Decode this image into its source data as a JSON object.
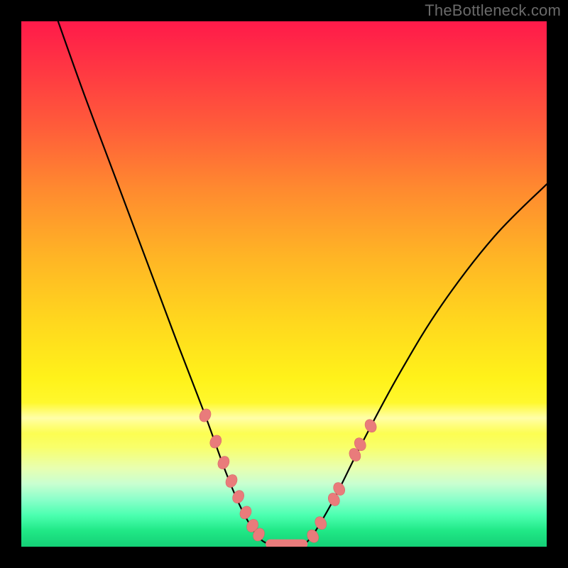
{
  "watermark": "TheBottleneck.com",
  "chart_data": {
    "type": "line",
    "title": "",
    "xlabel": "",
    "ylabel": "",
    "xlim": [
      0,
      100
    ],
    "ylim": [
      0,
      100
    ],
    "grid": false,
    "legend": false,
    "curves": [
      {
        "name": "left-branch",
        "points": [
          {
            "x": 7,
            "y": 100
          },
          {
            "x": 12,
            "y": 86
          },
          {
            "x": 18,
            "y": 70
          },
          {
            "x": 24,
            "y": 54
          },
          {
            "x": 30,
            "y": 38
          },
          {
            "x": 35,
            "y": 25
          },
          {
            "x": 39,
            "y": 14
          },
          {
            "x": 42,
            "y": 7
          },
          {
            "x": 45,
            "y": 2
          },
          {
            "x": 47,
            "y": 0.5
          }
        ]
      },
      {
        "name": "floor",
        "points": [
          {
            "x": 47,
            "y": 0.5
          },
          {
            "x": 54,
            "y": 0.5
          }
        ]
      },
      {
        "name": "right-branch",
        "points": [
          {
            "x": 54,
            "y": 0.5
          },
          {
            "x": 56,
            "y": 3
          },
          {
            "x": 60,
            "y": 10
          },
          {
            "x": 65,
            "y": 20
          },
          {
            "x": 72,
            "y": 33
          },
          {
            "x": 80,
            "y": 46
          },
          {
            "x": 90,
            "y": 59
          },
          {
            "x": 100,
            "y": 69
          }
        ]
      }
    ],
    "markers": [
      {
        "branch": "left",
        "x": 35.0,
        "y": 25.0
      },
      {
        "branch": "left",
        "x": 37.0,
        "y": 20.0
      },
      {
        "branch": "left",
        "x": 38.5,
        "y": 16.0
      },
      {
        "branch": "left",
        "x": 40.0,
        "y": 12.5
      },
      {
        "branch": "left",
        "x": 41.3,
        "y": 9.5
      },
      {
        "branch": "left",
        "x": 42.7,
        "y": 6.5
      },
      {
        "branch": "left",
        "x": 44.0,
        "y": 4.0
      },
      {
        "branch": "left",
        "x": 45.2,
        "y": 2.3
      },
      {
        "branch": "right",
        "x": 55.5,
        "y": 2.0
      },
      {
        "branch": "right",
        "x": 57.0,
        "y": 4.5
      },
      {
        "branch": "right",
        "x": 59.5,
        "y": 9.0
      },
      {
        "branch": "right",
        "x": 60.5,
        "y": 11.0
      },
      {
        "branch": "right",
        "x": 63.5,
        "y": 17.5
      },
      {
        "branch": "right",
        "x": 64.5,
        "y": 19.5
      },
      {
        "branch": "right",
        "x": 66.5,
        "y": 23.0
      }
    ],
    "floor_bar": {
      "x0": 46.5,
      "x1": 54.5,
      "y": 0.5,
      "thickness": 1.8
    },
    "colors": {
      "curve": "#000000",
      "markers": "#e97b7b",
      "gradient_top": "#ff1a4a",
      "gradient_mid": "#fff21a",
      "gradient_bottom": "#14cf76"
    }
  }
}
